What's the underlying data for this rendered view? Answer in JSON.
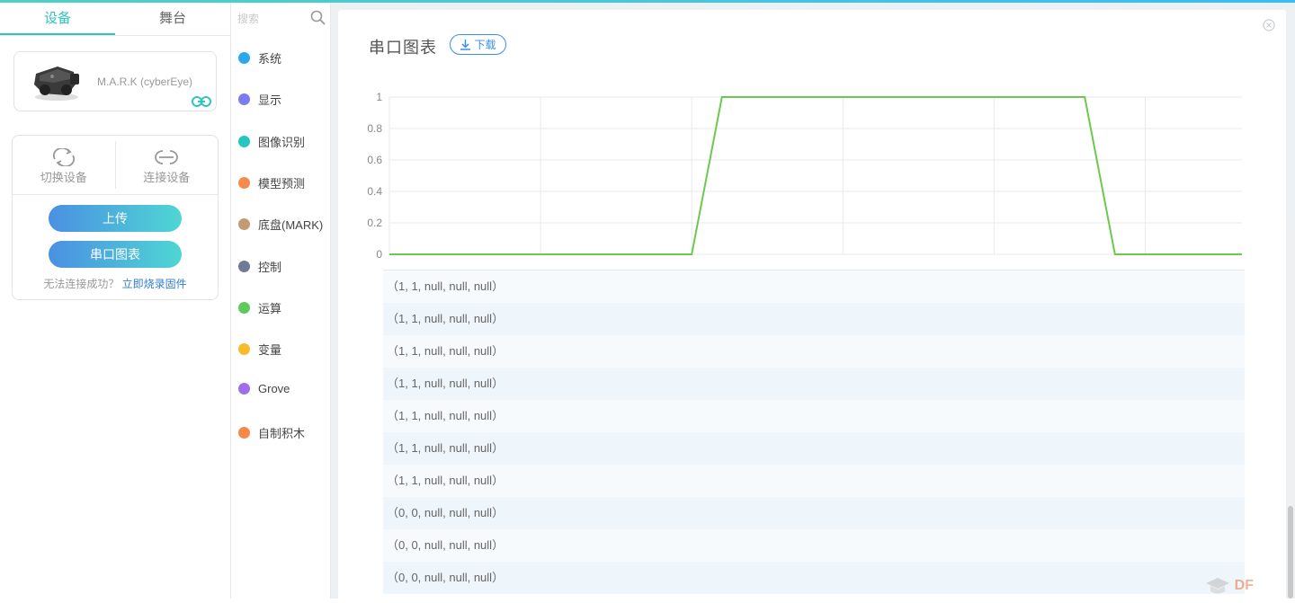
{
  "left_panel": {
    "tabs": [
      {
        "label": "设备",
        "active": true
      },
      {
        "label": "舞台",
        "active": false
      }
    ],
    "device": {
      "name": "M.A.R.K (cyberEye)"
    },
    "controls": {
      "switch_label": "切换设备",
      "connect_label": "连接设备",
      "upload_label": "上传",
      "serial_chart_label": "串口图表",
      "hint_text": "无法连接成功？",
      "hint_link": "立即烧录固件"
    }
  },
  "categories": {
    "search_placeholder": "搜索",
    "items": [
      {
        "label": "系统",
        "color": "#29a8f0"
      },
      {
        "label": "显示",
        "color": "#7b7cf0"
      },
      {
        "label": "图像识别",
        "color": "#22c7c2"
      },
      {
        "label": "模型预测",
        "color": "#f58b4d"
      },
      {
        "label": "底盘(MARK)",
        "color": "#c49a72"
      },
      {
        "label": "控制",
        "color": "#6e7b94"
      },
      {
        "label": "运算",
        "color": "#5ec95c"
      },
      {
        "label": "变量",
        "color": "#f7bc2e"
      },
      {
        "label": "Grove",
        "color": "#9d6ff0"
      },
      {
        "label": "自制积木",
        "color": "#f5894a"
      }
    ]
  },
  "main": {
    "title": "串口图表",
    "download_label": "下载",
    "rows": [
      "（1, 1, null, null, null）",
      "（1, 1, null, null, null）",
      "（1, 1, null, null, null）",
      "（1, 1, null, null, null）",
      "（1, 1, null, null, null）",
      "（1, 1, null, null, null）",
      "（1, 1, null, null, null）",
      "（0, 0, null, null, null）",
      "（0, 0, null, null, null）",
      "（0, 0, null, null, null）"
    ],
    "watermark": "DF"
  },
  "chart_data": {
    "type": "line",
    "title": "",
    "xlabel": "",
    "ylabel": "",
    "ylim": [
      0,
      1
    ],
    "yticks": [
      "0",
      "0.2",
      "0.4",
      "0.6",
      "0.8",
      "1"
    ],
    "grid": true,
    "series": [
      {
        "color": "#6cc94f",
        "x": [
          0,
          10,
          11,
          23,
          24,
          28.2
        ],
        "values": [
          0,
          0,
          1,
          1,
          0,
          0
        ]
      }
    ],
    "xlim": [
      0,
      28.2
    ]
  }
}
